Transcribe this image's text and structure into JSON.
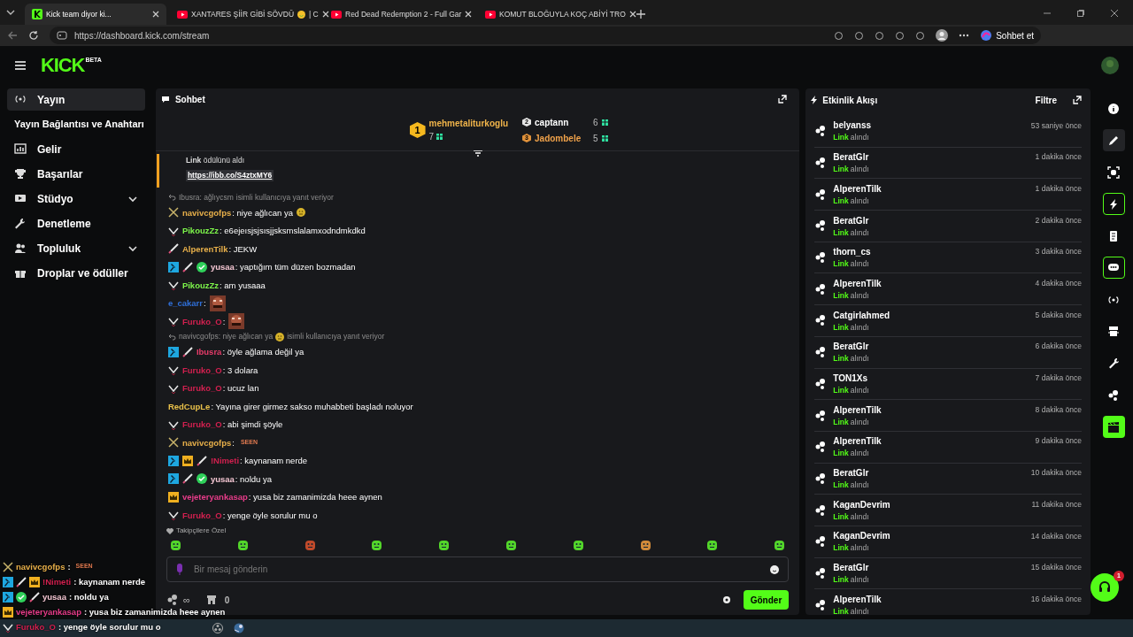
{
  "browser": {
    "tabs": [
      {
        "title": "Kick team diyor ki...",
        "kind": "kick",
        "selected": true
      },
      {
        "title": "XANTARES ŞİİR GİBİ SÖVDÜ",
        "emoji_tail": "| C",
        "kind": "video",
        "selected": false
      },
      {
        "title": "Red Dead Redemption 2 - Full Gar",
        "kind": "video",
        "selected": false
      },
      {
        "title": "KOMUT BLOĞUYLA KOÇ ABİYİ TRO",
        "kind": "video",
        "selected": false
      }
    ],
    "url": "https://dashboard.kick.com/stream",
    "copilot": "Sohbet et"
  },
  "header": {
    "logo": "KICK",
    "logo_tag": "BETA"
  },
  "sidebar": {
    "items": [
      {
        "label": "Yayın",
        "kind": "broadcast",
        "selected": true,
        "children": [
          {
            "label": "Yayın Bağlantısı ve Anahtarı"
          }
        ]
      },
      {
        "label": "Gelir",
        "kind": "chart",
        "selected": false
      },
      {
        "label": "Başarılar",
        "kind": "trophy",
        "selected": false
      },
      {
        "label": "Stüdyo",
        "kind": "studio",
        "selected": false,
        "expandable": true
      },
      {
        "label": "Denetleme",
        "kind": "wrench",
        "selected": false
      },
      {
        "label": "Topluluk",
        "kind": "people",
        "selected": false,
        "expandable": true
      },
      {
        "label": "Droplar ve ödüller",
        "kind": "gift",
        "selected": false
      }
    ]
  },
  "chat": {
    "title": "Sohbet",
    "leaderboard": [
      {
        "rank": "1",
        "name": "mehmetaliturkoglu",
        "count": "7"
      },
      {
        "rank": "2",
        "name": "captann",
        "count": "6"
      },
      {
        "rank": "3",
        "name": "Jadombele",
        "count": "5"
      }
    ],
    "pinned": {
      "text": "**Link** ödülünü aldı",
      "link": "https://ibb.co/S4ztxMY6"
    },
    "messages": [
      {
        "reply": {
          "quote": "Ibusra: ağlıycsm",
          "emoji": false,
          "suffix": "isimli kullanıcıya yanıt veriyor"
        },
        "badges": [
          {
            "kind": "swords"
          }
        ],
        "user": "navivcgofps",
        "color": "#e8b04a",
        "text": ": niye ağlıcan ya",
        "emoji": true
      },
      {
        "badges": [
          {
            "kind": "chevron"
          }
        ],
        "user": "PikouzZz",
        "color": "#7cf34a",
        "text": ": e6ejeısjsjsısjjsksmslalamxodndmkdkd"
      },
      {
        "badges": [
          {
            "kind": "pen"
          }
        ],
        "user": "AlperenTilk",
        "color": "#e8b04a",
        "text": ": JEKW"
      },
      {
        "badges": [
          {
            "kind": "mod"
          },
          {
            "kind": "pen"
          },
          {
            "kind": "verified"
          }
        ],
        "user": "yusaa",
        "color": "#f4c6d2",
        "text": ": yaptığım tüm düzen bozmadan"
      },
      {
        "badges": [
          {
            "kind": "chevron"
          }
        ],
        "user": "PikouzZz",
        "color": "#7cf34a",
        "text": ": am yusaaa"
      },
      {
        "user": "e_cakarr",
        "color": "#2f6fd8",
        "text": ":",
        "image_emote": true
      },
      {
        "badges": [
          {
            "kind": "chevron"
          }
        ],
        "user": "Furuko_O",
        "color": "#d1204f",
        "text": ":",
        "image_emote": true
      },
      {
        "reply": {
          "quote": "navivcgofps: niye ağlıcan ya",
          "emoji": true,
          "suffix": "isimli kullanıcıya yanıt veriyor"
        },
        "badges": [
          {
            "kind": "mod"
          },
          {
            "kind": "pen"
          }
        ],
        "user": "Ibusra",
        "color": "#e83c6a",
        "text": ": öyle ağlama değil ya"
      },
      {
        "badges": [
          {
            "kind": "chevron"
          }
        ],
        "user": "Furuko_O",
        "color": "#d1204f",
        "text": ": 3 dolara"
      },
      {
        "badges": [
          {
            "kind": "chevron"
          }
        ],
        "user": "Furuko_O",
        "color": "#d1204f",
        "text": ": ucuz lan"
      },
      {
        "user": "RedCupLe",
        "color": "#e8c04a",
        "text": ": Yayına girer girmez sakso muhabbeti başladı noluyor"
      },
      {
        "badges": [
          {
            "kind": "chevron"
          }
        ],
        "user": "Furuko_O",
        "color": "#d1204f",
        "text": ": abi şimdi şöyle"
      },
      {
        "badges": [
          {
            "kind": "swords"
          }
        ],
        "user": "navivcgofps",
        "color": "#e8b04a",
        "text": ":",
        "text_emote": "SEEN"
      },
      {
        "badges": [
          {
            "kind": "mod"
          },
          {
            "kind": "crown"
          },
          {
            "kind": "pen"
          }
        ],
        "user": "!Nimeti",
        "color": "#d1204f",
        "text": ": kaynanam nerde"
      },
      {
        "badges": [
          {
            "kind": "mod"
          },
          {
            "kind": "pen"
          },
          {
            "kind": "verified"
          }
        ],
        "user": "yusaa",
        "color": "#f4c6d2",
        "text": ": noldu ya"
      },
      {
        "badges": [
          {
            "kind": "crown"
          }
        ],
        "user": "vejeteryankasap",
        "color": "#e83c8a",
        "text": ": yusa biz zamanimizda heee aynen"
      },
      {
        "badges": [
          {
            "kind": "chevron"
          }
        ],
        "user": "Furuko_O",
        "color": "#d1204f",
        "text": ": yenge öyle sorulur mu o"
      }
    ],
    "emote_section": "Takipçilere Özel",
    "input": {
      "placeholder": "Bir mesaj gönderin"
    },
    "points": "∞",
    "drops": "0",
    "send": "Gönder"
  },
  "activity": {
    "title": "Etkinlik Akışı",
    "filter": "Filtre",
    "items": [
      {
        "user": "belyanss",
        "reward": "Link",
        "action": "alındı",
        "time": "53 saniye önce"
      },
      {
        "user": "BeratGlr",
        "reward": "Link",
        "action": "alındı",
        "time": "1 dakika önce"
      },
      {
        "user": "AlperenTilk",
        "reward": "Link",
        "action": "alındı",
        "time": "1 dakika önce"
      },
      {
        "user": "BeratGlr",
        "reward": "Link",
        "action": "alındı",
        "time": "2 dakika önce"
      },
      {
        "user": "thorn_cs",
        "reward": "Link",
        "action": "alındı",
        "time": "3 dakika önce"
      },
      {
        "user": "AlperenTilk",
        "reward": "Link",
        "action": "alındı",
        "time": "4 dakika önce"
      },
      {
        "user": "Catgirlahmed",
        "reward": "Link",
        "action": "alındı",
        "time": "5 dakika önce"
      },
      {
        "user": "BeratGlr",
        "reward": "Link",
        "action": "alındı",
        "time": "6 dakika önce"
      },
      {
        "user": "TON1Xs",
        "reward": "Link",
        "action": "alındı",
        "time": "7 dakika önce"
      },
      {
        "user": "AlperenTilk",
        "reward": "Link",
        "action": "alındı",
        "time": "8 dakika önce"
      },
      {
        "user": "AlperenTilk",
        "reward": "Link",
        "action": "alındı",
        "time": "9 dakika önce"
      },
      {
        "user": "BeratGlr",
        "reward": "Link",
        "action": "alındı",
        "time": "10 dakika önce"
      },
      {
        "user": "KaganDevrim",
        "reward": "Link",
        "action": "alındı",
        "time": "11 dakika önce"
      },
      {
        "user": "KaganDevrim",
        "reward": "Link",
        "action": "alındı",
        "time": "14 dakika önce"
      },
      {
        "user": "BeratGlr",
        "reward": "Link",
        "action": "alındı",
        "time": "15 dakika önce"
      },
      {
        "user": "AlperenTilk",
        "reward": "Link",
        "action": "alındı",
        "time": "16 dakika önce"
      }
    ]
  },
  "rail": [
    {
      "kind": "info",
      "selected": false
    },
    {
      "kind": "pencil",
      "selected": false,
      "hovered": true
    },
    {
      "kind": "scan",
      "selected": false
    },
    {
      "kind": "bolt",
      "selected": true
    },
    {
      "kind": "notes",
      "selected": false
    },
    {
      "kind": "chat",
      "selected": true
    },
    {
      "kind": "broadcast",
      "selected": false
    },
    {
      "kind": "camera",
      "selected": false
    },
    {
      "kind": "wrench",
      "selected": false
    },
    {
      "kind": "dots",
      "selected": false
    },
    {
      "kind": "clapper",
      "selected": false
    }
  ],
  "help": {
    "badge": "1"
  },
  "overlay": {
    "lines": [
      {
        "badges": [
          {
            "kind": "swords"
          }
        ],
        "user": "navivcgofps",
        "color": "#e8b04a",
        "text": ":",
        "text_emote": "SEEN"
      },
      {
        "badges": [
          {
            "kind": "mod"
          },
          {
            "kind": "pen"
          },
          {
            "kind": "crown"
          }
        ],
        "user": "!Nimeti",
        "color": "#d1204f",
        "text": ": kaynanam nerde"
      },
      {
        "badges": [
          {
            "kind": "mod"
          },
          {
            "kind": "verified"
          },
          {
            "kind": "pen"
          }
        ],
        "user": "yusaa",
        "color": "#f4c6d2",
        "text": ": noldu ya"
      },
      {
        "badges": [
          {
            "kind": "crown"
          }
        ],
        "user": "vejeteryankasap",
        "color": "#e83c8a",
        "text": ": yusa biz zamanimizda heee aynen"
      },
      {
        "badges": [
          {
            "kind": "chevron"
          }
        ],
        "user": "Furuko_O",
        "color": "#d1204f",
        "text": ": yenge öyle sorulur mu o"
      }
    ]
  }
}
